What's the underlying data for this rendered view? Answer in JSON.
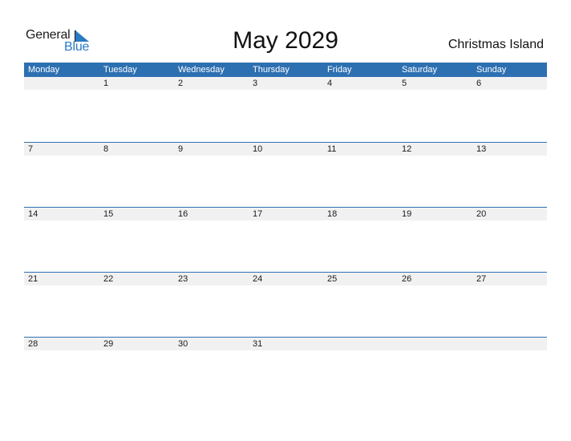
{
  "logo": {
    "word1": "General",
    "word2": "Blue",
    "accent": "#2a7ac4"
  },
  "title": "May 2029",
  "country": "Christmas Island",
  "colors": {
    "header_bg": "#2d70b2",
    "date_strip_bg": "#f1f1f1"
  },
  "weekdays": [
    "Monday",
    "Tuesday",
    "Wednesday",
    "Thursday",
    "Friday",
    "Saturday",
    "Sunday"
  ],
  "weeks": [
    [
      "",
      "1",
      "2",
      "3",
      "4",
      "5",
      "6"
    ],
    [
      "7",
      "8",
      "9",
      "10",
      "11",
      "12",
      "13"
    ],
    [
      "14",
      "15",
      "16",
      "17",
      "18",
      "19",
      "20"
    ],
    [
      "21",
      "22",
      "23",
      "24",
      "25",
      "26",
      "27"
    ],
    [
      "28",
      "29",
      "30",
      "31",
      "",
      "",
      ""
    ]
  ]
}
